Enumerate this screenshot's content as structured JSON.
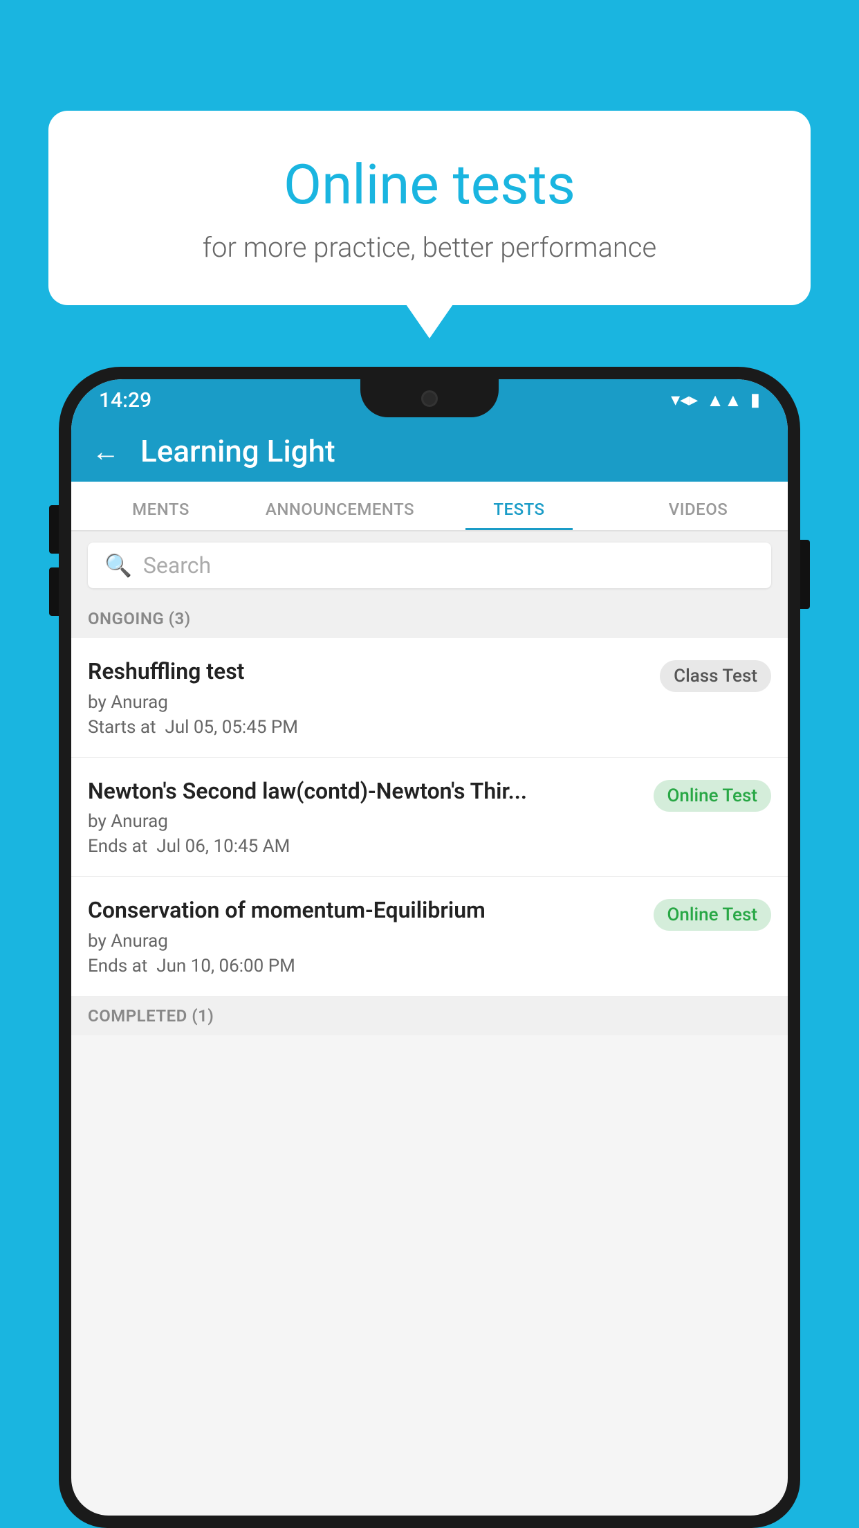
{
  "background_color": "#1ab5e0",
  "bubble": {
    "title": "Online tests",
    "subtitle": "for more practice, better performance"
  },
  "status_bar": {
    "time": "14:29",
    "icons": [
      "wifi",
      "signal",
      "battery"
    ]
  },
  "app_header": {
    "title": "Learning Light",
    "back_label": "←"
  },
  "tabs": [
    {
      "label": "MENTS",
      "active": false
    },
    {
      "label": "ANNOUNCEMENTS",
      "active": false
    },
    {
      "label": "TESTS",
      "active": true
    },
    {
      "label": "VIDEOS",
      "active": false
    }
  ],
  "search": {
    "placeholder": "Search"
  },
  "sections": {
    "ongoing": {
      "label": "ONGOING (3)",
      "tests": [
        {
          "name": "Reshuffling test",
          "author": "by Anurag",
          "time_label": "Starts at",
          "time": "Jul 05, 05:45 PM",
          "badge": "Class Test",
          "badge_type": "class"
        },
        {
          "name": "Newton's Second law(contd)-Newton's Thir...",
          "author": "by Anurag",
          "time_label": "Ends at",
          "time": "Jul 06, 10:45 AM",
          "badge": "Online Test",
          "badge_type": "online"
        },
        {
          "name": "Conservation of momentum-Equilibrium",
          "author": "by Anurag",
          "time_label": "Ends at",
          "time": "Jun 10, 06:00 PM",
          "badge": "Online Test",
          "badge_type": "online"
        }
      ]
    },
    "completed": {
      "label": "COMPLETED (1)"
    }
  }
}
